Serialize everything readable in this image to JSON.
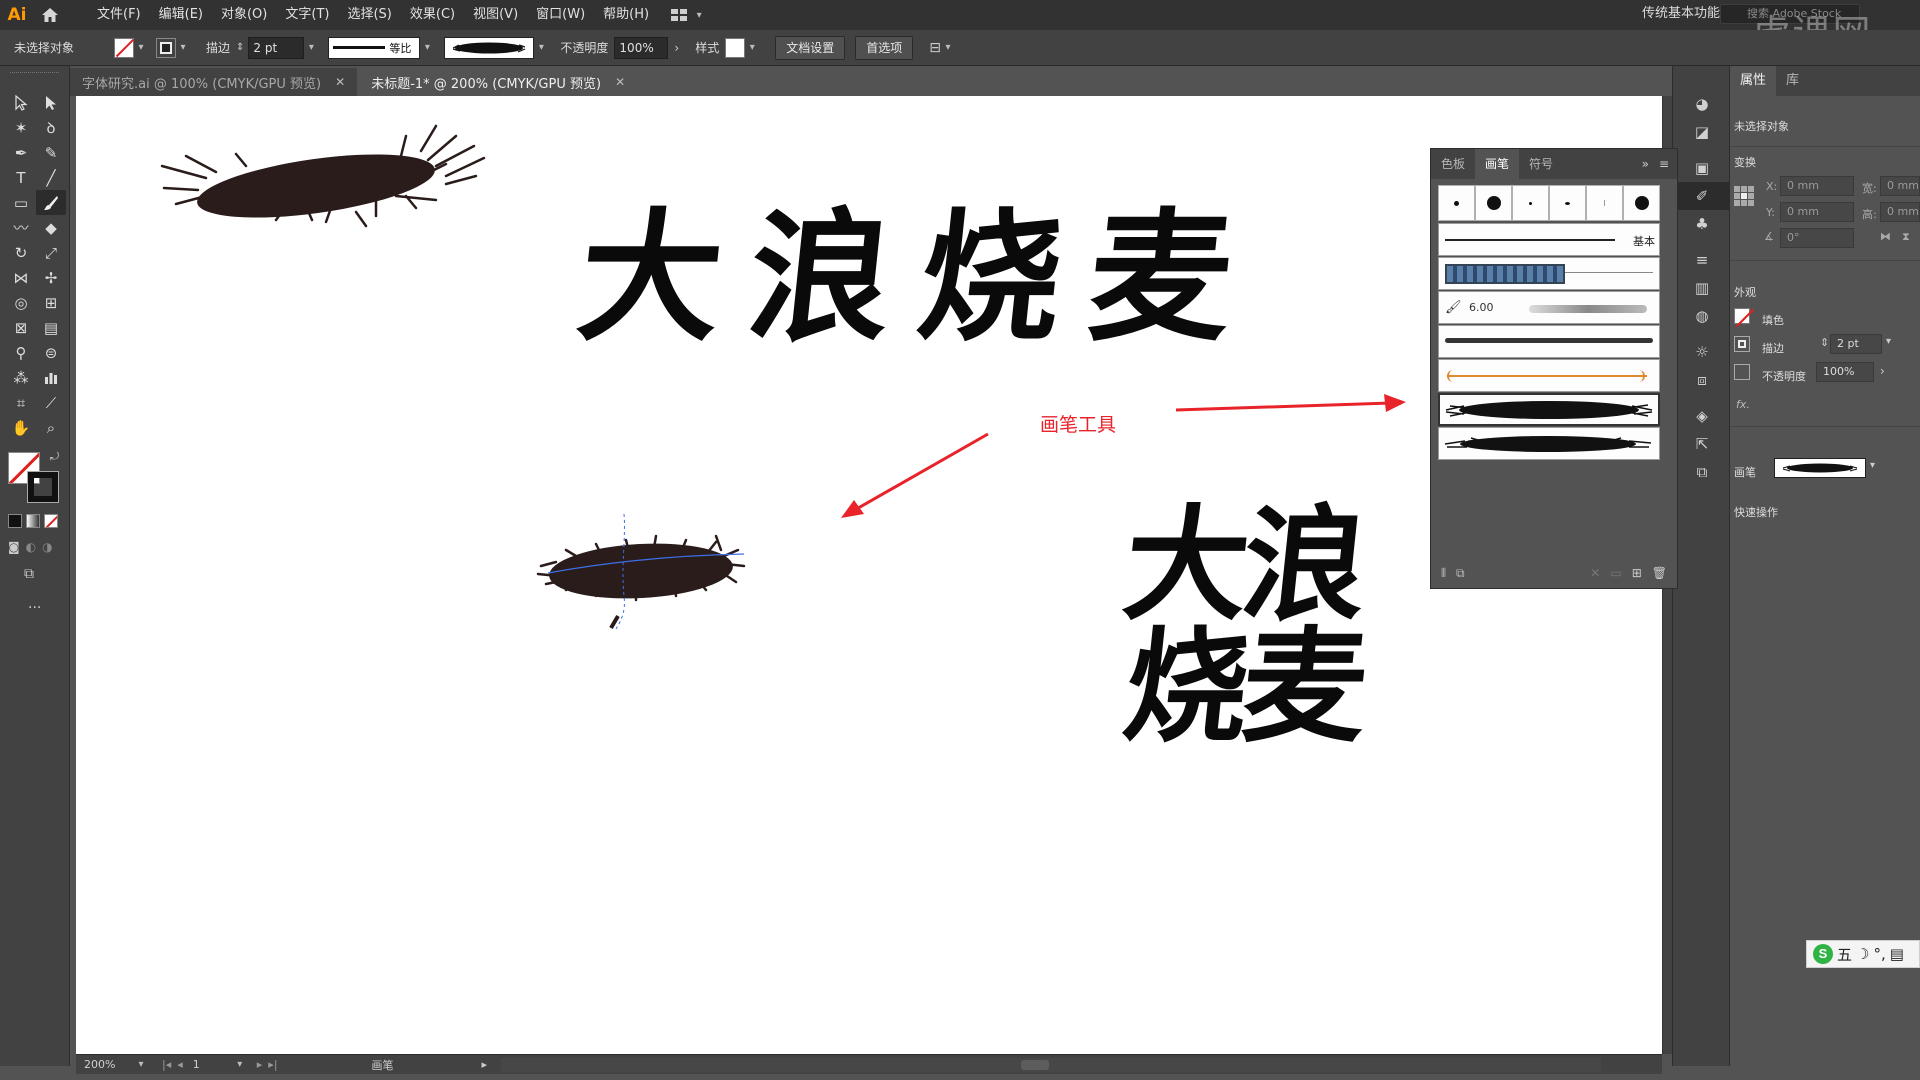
{
  "menubar": {
    "logo": "Ai",
    "items": [
      "文件(F)",
      "编辑(E)",
      "对象(O)",
      "文字(T)",
      "选择(S)",
      "效果(C)",
      "视图(V)",
      "窗口(W)",
      "帮助(H)"
    ],
    "workspace": "传统基本功能",
    "stock_search_placeholder": "搜索 Adobe Stock"
  },
  "controlbar": {
    "selection_status": "未选择对象",
    "stroke_label": "描边",
    "stroke_weight": "2 pt",
    "stroke_profile": "等比",
    "opacity_label": "不透明度",
    "opacity_value": "100%",
    "style_label": "样式",
    "doc_setup_button": "文档设置",
    "preferences_button": "首选项"
  },
  "tabs": [
    {
      "label": "字体研究.ai @ 100% (CMYK/GPU 预览)",
      "active": false
    },
    {
      "label": "未标题-1* @ 200% (CMYK/GPU 预览)",
      "active": true
    }
  ],
  "canvas": {
    "headline": "大浪烧麦",
    "stack_top": "大浪",
    "stack_bottom": "烧麦",
    "annotation": "画笔工具"
  },
  "brush_panel": {
    "tabs": [
      "色板",
      "画笔",
      "符号"
    ],
    "active_tab": "画笔",
    "basic_label": "基本",
    "size_value": "6.00"
  },
  "status": {
    "zoom": "200%",
    "page": "1",
    "tool_name": "画笔"
  },
  "properties": {
    "tabs": [
      "属性",
      "库"
    ],
    "selection_status": "未选择对象",
    "transform_label": "变换",
    "x_label": "X:",
    "y_label": "Y:",
    "w_label": "宽:",
    "h_label": "高:",
    "x_value": "0 mm",
    "y_value": "0 mm",
    "w_value": "0 mm",
    "h_value": "0 mm",
    "angle_value": "0°",
    "appearance_label": "外观",
    "fill_label": "填色",
    "stroke_label": "描边",
    "stroke_value": "2 pt",
    "opacity_label": "不透明度",
    "opacity_value": "100%",
    "fx_label": "fx.",
    "brush_label": "画笔",
    "quick_actions_label": "快速操作"
  },
  "ime": {
    "mode": "五"
  },
  "watermark": "虎课网",
  "colors": {
    "accent_red": "#e8232a",
    "ai_orange": "#ff9a00",
    "ink": "#2a1c1a"
  }
}
